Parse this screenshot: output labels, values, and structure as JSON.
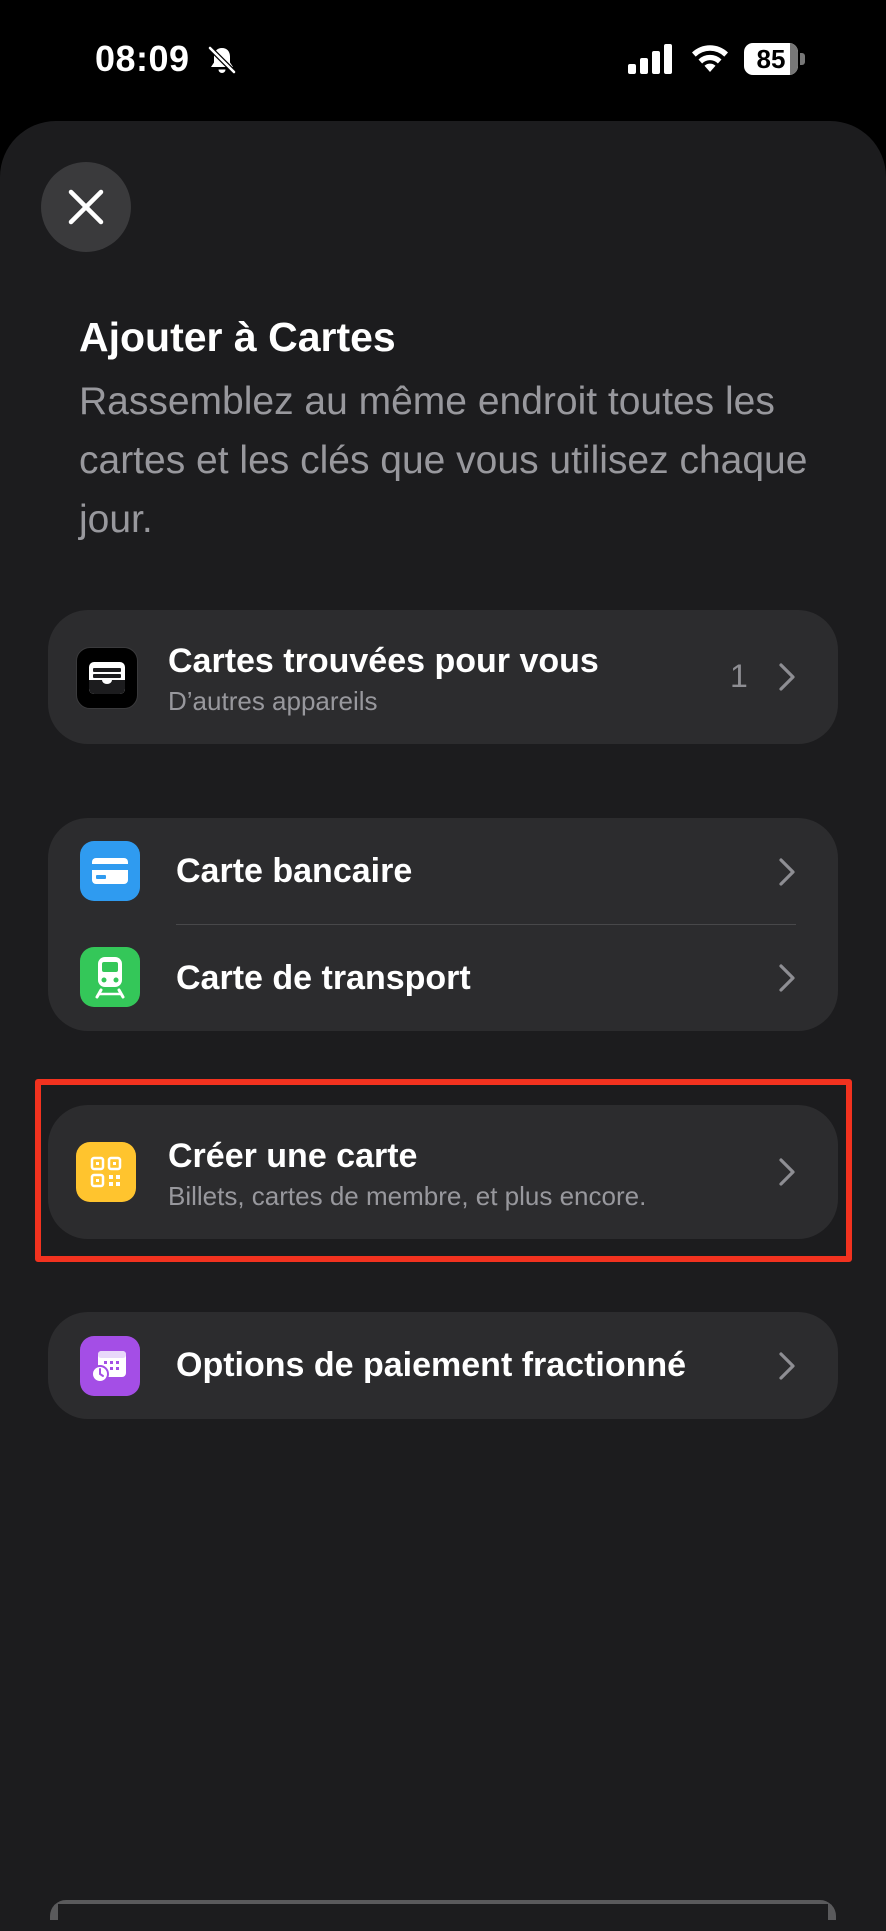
{
  "status_bar": {
    "time": "08:09",
    "battery": "85",
    "icons": [
      "bell-slash-icon",
      "cellular-signal-icon",
      "wifi-icon",
      "battery-icon"
    ]
  },
  "header": {
    "close_icon": "xmark-icon",
    "title": "Ajouter à Cartes",
    "subtitle": "Rassemblez au même endroit toutes les cartes et les clés que vous utilisez chaque jour."
  },
  "found_cards": {
    "title": "Cartes trouvées pour vous",
    "subtitle": "D’autres appareils",
    "count": "1",
    "icon": "wallet-icon"
  },
  "card_types": [
    {
      "title": "Carte bancaire",
      "icon": "credit-card-icon",
      "color": "#2f9bf0"
    },
    {
      "title": "Carte de transport",
      "icon": "train-icon",
      "color": "#34c759"
    }
  ],
  "create_card": {
    "title": "Créer une carte",
    "subtitle": "Billets, cartes de membre, et plus encore.",
    "icon": "qr-code-icon",
    "color": "#ffc42e"
  },
  "installments": {
    "title": "Options de paiement fractionné",
    "icon": "calendar-clock-icon",
    "color": "#a44ee6"
  },
  "highlight_color": "#f2321f"
}
